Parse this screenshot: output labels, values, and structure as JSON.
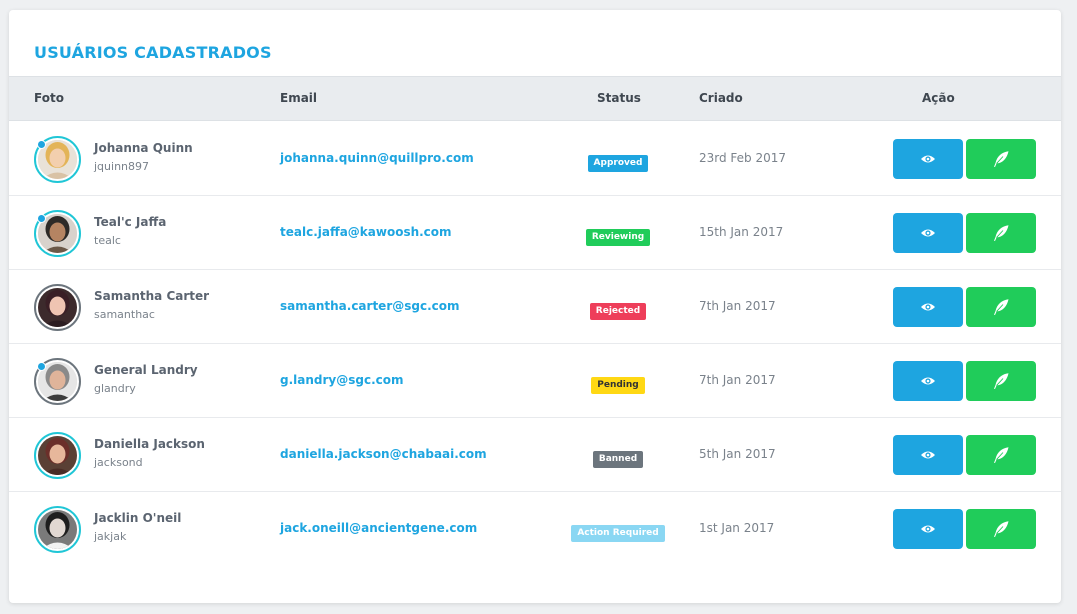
{
  "title": "USUÁRIOS CADASTRADOS",
  "columns": {
    "foto": "Foto",
    "email": "Email",
    "status": "Status",
    "criado": "Criado",
    "acao": "Ação"
  },
  "colors": {
    "accent": "#1ea5e0",
    "approved": "#1ea5e0",
    "reviewing": "#20cc5a",
    "rejected": "#ee3e5a",
    "pending": "#ffd814",
    "banned": "#6c757d",
    "action_required": "#8ad7f3",
    "edit_button": "#20cc5a",
    "view_button": "#1ea5e0"
  },
  "actions": {
    "view_icon": "eye-icon",
    "edit_icon": "feather-icon"
  },
  "users": [
    {
      "name": "Johanna Quinn",
      "username": "jquinn897",
      "email": "johanna.quinn@quillpro.com",
      "status": "Approved",
      "status_key": "approved",
      "created": "23rd Feb 2017",
      "online": true
    },
    {
      "name": "Teal'c Jaffa",
      "username": "tealc",
      "email": "tealc.jaffa@kawoosh.com",
      "status": "Reviewing",
      "status_key": "reviewing",
      "created": "15th Jan 2017",
      "online": true
    },
    {
      "name": "Samantha Carter",
      "username": "samanthac",
      "email": "samantha.carter@sgc.com",
      "status": "Rejected",
      "status_key": "rejected",
      "created": "7th Jan 2017",
      "online": false
    },
    {
      "name": "General Landry",
      "username": "glandry",
      "email": "g.landry@sgc.com",
      "status": "Pending",
      "status_key": "pending",
      "created": "7th Jan 2017",
      "online": true
    },
    {
      "name": "Daniella Jackson",
      "username": "jacksond",
      "email": "daniella.jackson@chabaai.com",
      "status": "Banned",
      "status_key": "banned",
      "created": "5th Jan 2017",
      "online": false
    },
    {
      "name": "Jacklin O'neil",
      "username": "jakjak",
      "email": "jack.oneill@ancientgene.com",
      "status": "Action Required",
      "status_key": "action_required",
      "created": "1st Jan 2017",
      "online": false
    }
  ]
}
